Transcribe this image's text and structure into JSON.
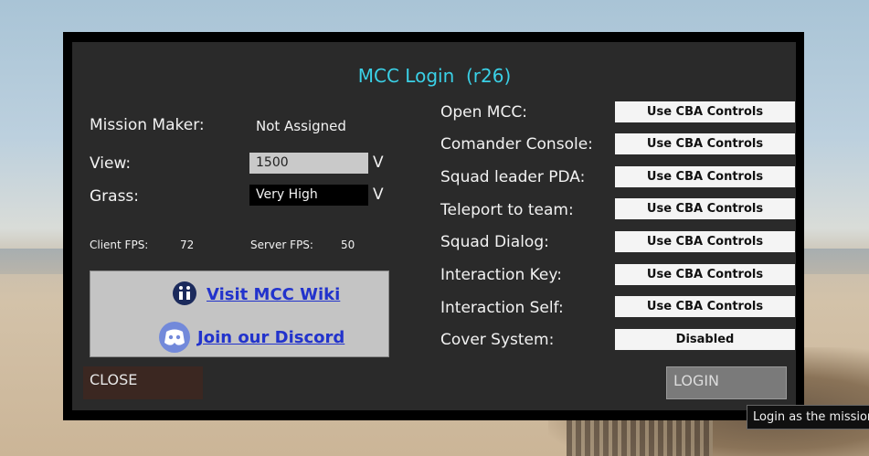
{
  "title": "MCC Login  (r26)",
  "left": {
    "mission_maker_label": "Mission Maker:",
    "mission_maker_value": "Not Assigned",
    "view_label": "View:",
    "view_value": "1500",
    "grass_label": "Grass:",
    "grass_value": "Very High",
    "dropdown_arrow": "V",
    "client_fps_label": "Client FPS:",
    "client_fps_value": "72",
    "server_fps_label": "Server FPS:",
    "server_fps_value": "50"
  },
  "links": {
    "wiki_label": "Visit MCC Wiki",
    "discord_label": "Join our Discord"
  },
  "controls": [
    {
      "label": "Open MCC:",
      "value": "Use CBA Controls"
    },
    {
      "label": "Comander Console:",
      "value": "Use CBA Controls"
    },
    {
      "label": "Squad leader PDA:",
      "value": "Use CBA Controls"
    },
    {
      "label": "Teleport to team:",
      "value": "Use CBA Controls"
    },
    {
      "label": "Squad Dialog:",
      "value": "Use CBA Controls"
    },
    {
      "label": "Interaction Key:",
      "value": "Use CBA Controls"
    },
    {
      "label": "Interaction Self:",
      "value": "Use CBA Controls"
    },
    {
      "label": "Cover System:",
      "value": "Disabled"
    }
  ],
  "buttons": {
    "close": "CLOSE",
    "login": "LOGIN"
  },
  "tooltip": "Login as the mission m",
  "colors": {
    "title": "#3ad0e6",
    "panel": "#2a2a2a",
    "link": "#2233cc"
  }
}
